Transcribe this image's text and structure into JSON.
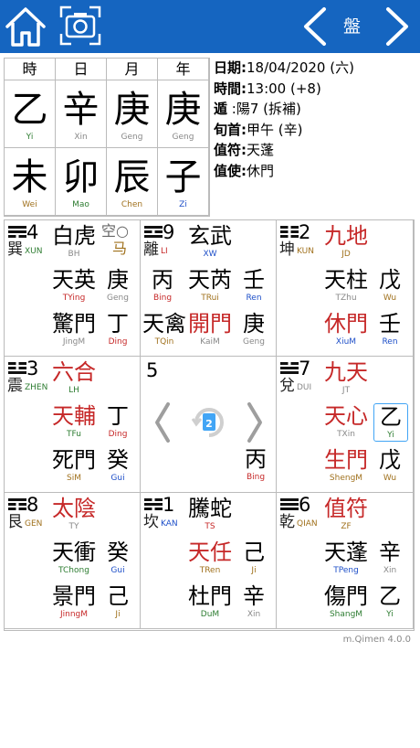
{
  "toolbar": {
    "title": "盤"
  },
  "icons": {
    "home": "home-icon",
    "camera": "camera-icon",
    "prev": "chevron-left-icon",
    "next": "chevron-right-icon",
    "center": "rotate-page-icon"
  },
  "pillars": {
    "headers": [
      "時",
      "日",
      "月",
      "年"
    ],
    "stems": [
      {
        "char": "乙",
        "pinyin": "Yi",
        "color": "#2e7d32"
      },
      {
        "char": "辛",
        "pinyin": "Xin",
        "color": "#888888"
      },
      {
        "char": "庚",
        "pinyin": "Geng",
        "color": "#888888"
      },
      {
        "char": "庚",
        "pinyin": "Geng",
        "color": "#888888"
      }
    ],
    "branches": [
      {
        "char": "未",
        "pinyin": "Wei",
        "color": "#a0711d"
      },
      {
        "char": "卯",
        "pinyin": "Mao",
        "color": "#2e7d32"
      },
      {
        "char": "辰",
        "pinyin": "Chen",
        "color": "#a0711d"
      },
      {
        "char": "子",
        "pinyin": "Zi",
        "color": "#1e4fc8"
      }
    ]
  },
  "info": [
    {
      "key": "日期:",
      "value": "18/04/2020 (六)"
    },
    {
      "key": "時間:",
      "value": "13:00 (+8)"
    },
    {
      "key": "遁",
      "value": "  :陽7 (拆補)"
    },
    {
      "key": "旬首:",
      "value": "甲午 (辛)"
    },
    {
      "key": "值符:",
      "value": "天蓬"
    },
    {
      "key": "值使:",
      "value": "休門"
    }
  ],
  "palaces": [
    {
      "num": "4",
      "trigram": "巽",
      "pinyin": "XUN",
      "lines": [
        1,
        1,
        0
      ],
      "god": {
        "c": "白虎",
        "p": "BH",
        "color": "#000000",
        "pcolor": "#888888"
      },
      "star": {
        "c": "天英",
        "p": "TYing",
        "color": "#000000",
        "pcolor": "#c62828"
      },
      "door": {
        "c": "驚門",
        "p": "JingM",
        "color": "#000000",
        "pcolor": "#888888"
      },
      "stem_top": {
        "c": "庚",
        "p": "Geng",
        "color": "#000000",
        "pcolor": "#888888"
      },
      "stem_bot": {
        "c": "丁",
        "p": "Ding",
        "color": "#000000",
        "pcolor": "#c62828"
      },
      "extra_mark": "空○",
      "extra_mark2": "马"
    },
    {
      "num": "9",
      "trigram": "離",
      "pinyin": "LI",
      "lines": [
        1,
        0,
        1
      ],
      "god": {
        "c": "玄武",
        "p": "XW",
        "color": "#000000",
        "pcolor": "#1e4fc8"
      },
      "star": {
        "c": "天芮",
        "p": "TRui",
        "color": "#000000",
        "pcolor": "#a0711d"
      },
      "door": {
        "c": "開門",
        "p": "KaiM",
        "color": "#c62828",
        "pcolor": "#888888"
      },
      "stem_top": {
        "c": "壬",
        "p": "Ren",
        "color": "#000000",
        "pcolor": "#1e4fc8"
      },
      "stem_bot": {
        "c": "庚",
        "p": "Geng",
        "color": "#000000",
        "pcolor": "#888888"
      },
      "left_top": {
        "c": "丙",
        "p": "Bing",
        "color": "#000000",
        "pcolor": "#c62828"
      },
      "left_bot": {
        "c": "天禽",
        "p": "TQin",
        "color": "#000000",
        "pcolor": "#a0711d"
      }
    },
    {
      "num": "2",
      "trigram": "坤",
      "pinyin": "KUN",
      "lines": [
        0,
        0,
        0
      ],
      "god": {
        "c": "九地",
        "p": "JD",
        "color": "#c62828",
        "pcolor": "#a0711d"
      },
      "star": {
        "c": "天柱",
        "p": "TZhu",
        "color": "#000000",
        "pcolor": "#888888"
      },
      "door": {
        "c": "休門",
        "p": "XiuM",
        "color": "#c62828",
        "pcolor": "#1e4fc8"
      },
      "stem_top": {
        "c": "戊",
        "p": "Wu",
        "color": "#000000",
        "pcolor": "#a0711d"
      },
      "stem_bot": {
        "c": "壬",
        "p": "Ren",
        "color": "#000000",
        "pcolor": "#1e4fc8"
      }
    },
    {
      "num": "3",
      "trigram": "震",
      "pinyin": "ZHEN",
      "lines": [
        0,
        0,
        1
      ],
      "god": {
        "c": "六合",
        "p": "LH",
        "color": "#c62828",
        "pcolor": "#2e7d32"
      },
      "star": {
        "c": "天輔",
        "p": "TFu",
        "color": "#c62828",
        "pcolor": "#2e7d32"
      },
      "door": {
        "c": "死門",
        "p": "SiM",
        "color": "#000000",
        "pcolor": "#a0711d"
      },
      "stem_top": {
        "c": "丁",
        "p": "Ding",
        "color": "#000000",
        "pcolor": "#c62828"
      },
      "stem_bot": {
        "c": "癸",
        "p": "Gui",
        "color": "#000000",
        "pcolor": "#1e4fc8"
      }
    },
    {
      "num": "5",
      "center": true,
      "stem_bot": {
        "c": "丙",
        "p": "Bing",
        "color": "#000000",
        "pcolor": "#c62828"
      }
    },
    {
      "num": "7",
      "trigram": "兌",
      "pinyin": "DUI",
      "lines": [
        0,
        1,
        1
      ],
      "god": {
        "c": "九天",
        "p": "JT",
        "color": "#c62828",
        "pcolor": "#888888"
      },
      "star": {
        "c": "天心",
        "p": "TXin",
        "color": "#c62828",
        "pcolor": "#888888"
      },
      "door": {
        "c": "生門",
        "p": "ShengM",
        "color": "#c62828",
        "pcolor": "#a0711d"
      },
      "stem_top": {
        "c": "乙",
        "p": "Yi",
        "color": "#000000",
        "pcolor": "#2e7d32",
        "boxed": true
      },
      "stem_bot": {
        "c": "戊",
        "p": "Wu",
        "color": "#000000",
        "pcolor": "#a0711d"
      }
    },
    {
      "num": "8",
      "trigram": "艮",
      "pinyin": "GEN",
      "lines": [
        1,
        0,
        0
      ],
      "god": {
        "c": "太陰",
        "p": "TY",
        "color": "#c62828",
        "pcolor": "#888888"
      },
      "star": {
        "c": "天衝",
        "p": "TChong",
        "color": "#000000",
        "pcolor": "#2e7d32"
      },
      "door": {
        "c": "景門",
        "p": "JinngM",
        "color": "#000000",
        "pcolor": "#c62828"
      },
      "stem_top": {
        "c": "癸",
        "p": "Gui",
        "color": "#000000",
        "pcolor": "#1e4fc8"
      },
      "stem_bot": {
        "c": "己",
        "p": "Ji",
        "color": "#000000",
        "pcolor": "#a0711d"
      }
    },
    {
      "num": "1",
      "trigram": "坎",
      "pinyin": "KAN",
      "lines": [
        0,
        1,
        0
      ],
      "god": {
        "c": "騰蛇",
        "p": "TS",
        "color": "#000000",
        "pcolor": "#c62828"
      },
      "star": {
        "c": "天任",
        "p": "TRen",
        "color": "#c62828",
        "pcolor": "#a0711d"
      },
      "door": {
        "c": "杜門",
        "p": "DuM",
        "color": "#000000",
        "pcolor": "#2e7d32"
      },
      "stem_top": {
        "c": "己",
        "p": "Ji",
        "color": "#000000",
        "pcolor": "#a0711d"
      },
      "stem_bot": {
        "c": "辛",
        "p": "Xin",
        "color": "#000000",
        "pcolor": "#888888"
      }
    },
    {
      "num": "6",
      "trigram": "乾",
      "pinyin": "QIAN",
      "lines": [
        1,
        1,
        1
      ],
      "god": {
        "c": "值符",
        "p": "ZF",
        "color": "#c62828",
        "pcolor": "#a0711d"
      },
      "star": {
        "c": "天蓬",
        "p": "TPeng",
        "color": "#000000",
        "pcolor": "#1e4fc8"
      },
      "door": {
        "c": "傷門",
        "p": "ShangM",
        "color": "#000000",
        "pcolor": "#2e7d32"
      },
      "stem_top": {
        "c": "辛",
        "p": "Xin",
        "color": "#000000",
        "pcolor": "#888888"
      },
      "stem_bot": {
        "c": "乙",
        "p": "Yi",
        "color": "#000000",
        "pcolor": "#2e7d32"
      }
    }
  ],
  "version": "m.Qimen 4.0.0"
}
